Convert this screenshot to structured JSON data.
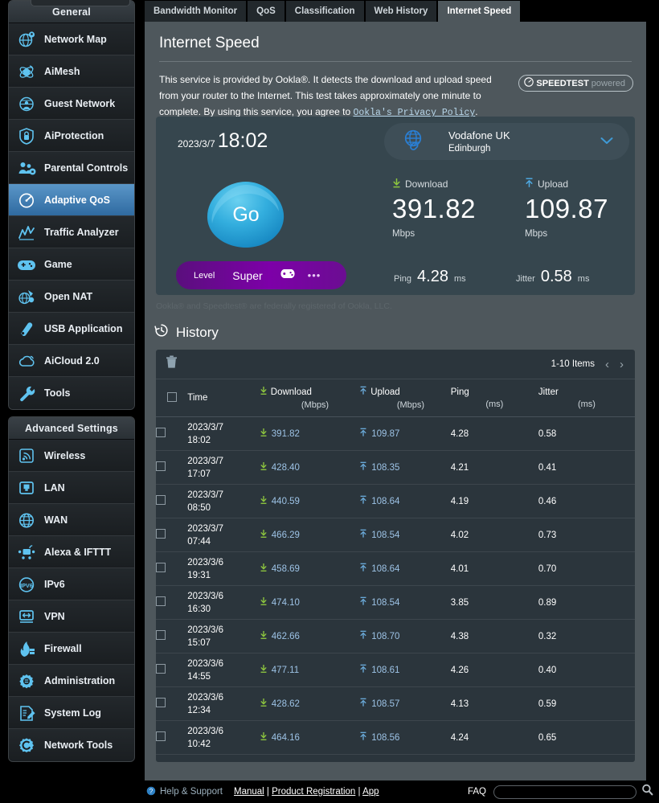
{
  "sidebar": {
    "general_header": "General",
    "advanced_header": "Advanced Settings",
    "general_items": [
      {
        "label": "Network Map",
        "icon": "network-map-icon",
        "active": false
      },
      {
        "label": "AiMesh",
        "icon": "aimesh-icon",
        "active": false
      },
      {
        "label": "Guest Network",
        "icon": "guest-network-icon",
        "active": false
      },
      {
        "label": "AiProtection",
        "icon": "aiprotection-shield-icon",
        "active": false
      },
      {
        "label": "Parental Controls",
        "icon": "parental-controls-icon",
        "active": false
      },
      {
        "label": "Adaptive QoS",
        "icon": "adaptive-qos-gauge-icon",
        "active": true
      },
      {
        "label": "Traffic Analyzer",
        "icon": "traffic-analyzer-icon",
        "active": false
      },
      {
        "label": "Game",
        "icon": "gamepad-icon",
        "active": false
      },
      {
        "label": "Open NAT",
        "icon": "open-nat-icon",
        "active": false
      },
      {
        "label": "USB Application",
        "icon": "usb-icon",
        "active": false
      },
      {
        "label": "AiCloud 2.0",
        "icon": "cloud-icon",
        "active": false
      },
      {
        "label": "Tools",
        "icon": "wrench-icon",
        "active": false
      }
    ],
    "advanced_items": [
      {
        "label": "Wireless",
        "icon": "wireless-signal-icon"
      },
      {
        "label": "LAN",
        "icon": "lan-port-icon"
      },
      {
        "label": "WAN",
        "icon": "wan-globe-icon"
      },
      {
        "label": "Alexa & IFTTT",
        "icon": "alexa-ifttt-icon"
      },
      {
        "label": "IPv6",
        "icon": "ipv6-icon"
      },
      {
        "label": "VPN",
        "icon": "vpn-icon"
      },
      {
        "label": "Firewall",
        "icon": "firewall-flame-icon"
      },
      {
        "label": "Administration",
        "icon": "administration-gear-icon"
      },
      {
        "label": "System Log",
        "icon": "system-log-icon"
      },
      {
        "label": "Network Tools",
        "icon": "network-tools-gear-icon"
      }
    ]
  },
  "tabs": [
    {
      "label": "Bandwidth Monitor",
      "active": false
    },
    {
      "label": "QoS",
      "active": false
    },
    {
      "label": "Classification",
      "active": false
    },
    {
      "label": "Web History",
      "active": false
    },
    {
      "label": "Internet Speed",
      "active": true
    }
  ],
  "page": {
    "title": "Internet Speed",
    "intro_before": "This service is provided by Ookla®. It detects the download and upload speed from your router to the Internet. This test takes approximately one minute to complete. By using this service, you agree to ",
    "intro_link": "Ookla's Privacy Policy",
    "intro_after": ".",
    "speedtest_badge_main": "SPEEDTEST",
    "speedtest_badge_sub": "powered",
    "ookla_note": "Ookla® and Speedtest® are federally registered of Ookla, LLC."
  },
  "speedcard": {
    "date": "2023/3/7",
    "time": "18:02",
    "server_name": "Vodafone UK",
    "server_city": "Edinburgh",
    "go_label": "Go",
    "download_label": "Download",
    "download_value": "391.82",
    "download_unit": "Mbps",
    "upload_label": "Upload",
    "upload_value": "109.87",
    "upload_unit": "Mbps",
    "level_label": "Level",
    "level_value": "Super",
    "level_more": "•••",
    "ping_label": "Ping",
    "ping_value": "4.28",
    "ping_unit": "ms",
    "jitter_label": "Jitter",
    "jitter_value": "0.58",
    "jitter_unit": "ms",
    "accent_blue": "#29a8dd",
    "level_purple": "#7d00a8"
  },
  "history": {
    "title": "History",
    "pager_text": "1-10 Items",
    "prev": "‹",
    "next": "›",
    "columns": [
      {
        "label": "Time",
        "unit": ""
      },
      {
        "label": "Download",
        "unit": "(Mbps)"
      },
      {
        "label": "Upload",
        "unit": "(Mbps)"
      },
      {
        "label": "Ping",
        "unit": "(ms)"
      },
      {
        "label": "Jitter",
        "unit": "(ms)"
      }
    ],
    "rows": [
      {
        "date": "2023/3/7",
        "time": "18:02",
        "download": "391.82",
        "upload": "109.87",
        "ping": "4.28",
        "jitter": "0.58"
      },
      {
        "date": "2023/3/7",
        "time": "17:07",
        "download": "428.40",
        "upload": "108.35",
        "ping": "4.21",
        "jitter": "0.41"
      },
      {
        "date": "2023/3/7",
        "time": "08:50",
        "download": "440.59",
        "upload": "108.64",
        "ping": "4.19",
        "jitter": "0.46"
      },
      {
        "date": "2023/3/7",
        "time": "07:44",
        "download": "466.29",
        "upload": "108.54",
        "ping": "4.02",
        "jitter": "0.73"
      },
      {
        "date": "2023/3/6",
        "time": "19:31",
        "download": "458.69",
        "upload": "108.64",
        "ping": "4.01",
        "jitter": "0.70"
      },
      {
        "date": "2023/3/6",
        "time": "16:30",
        "download": "474.10",
        "upload": "108.54",
        "ping": "3.85",
        "jitter": "0.89"
      },
      {
        "date": "2023/3/6",
        "time": "15:07",
        "download": "462.66",
        "upload": "108.70",
        "ping": "4.38",
        "jitter": "0.32"
      },
      {
        "date": "2023/3/6",
        "time": "14:55",
        "download": "477.11",
        "upload": "108.61",
        "ping": "4.26",
        "jitter": "0.40"
      },
      {
        "date": "2023/3/6",
        "time": "12:34",
        "download": "428.62",
        "upload": "108.57",
        "ping": "4.13",
        "jitter": "0.59"
      },
      {
        "date": "2023/3/6",
        "time": "10:42",
        "download": "464.16",
        "upload": "108.56",
        "ping": "4.24",
        "jitter": "0.65"
      }
    ]
  },
  "footer": {
    "help": "Help & Support",
    "manual": "Manual",
    "product_registration": "Product Registration",
    "app": "App",
    "sep": "|",
    "faq": "FAQ",
    "search_value": ""
  }
}
